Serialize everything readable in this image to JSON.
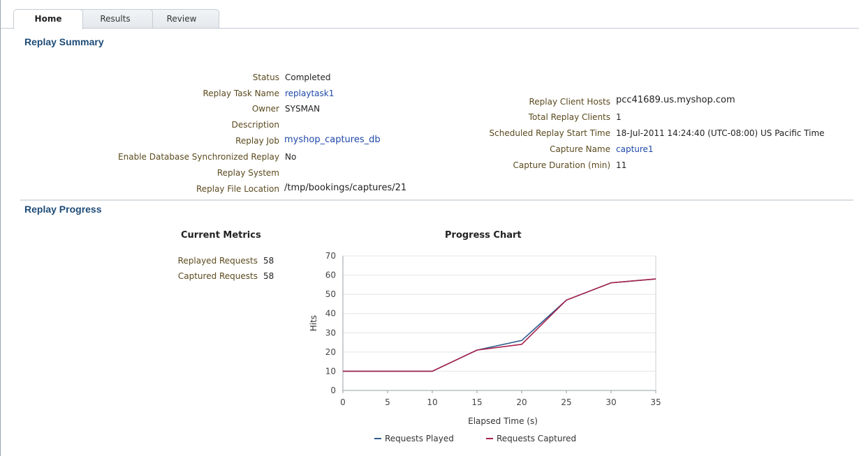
{
  "tabs": [
    {
      "label": "Home",
      "active": true
    },
    {
      "label": "Results",
      "active": false
    },
    {
      "label": "Review",
      "active": false
    }
  ],
  "replay_summary": {
    "title": "Replay Summary",
    "left_fields": [
      {
        "label": "Status",
        "value": "Completed"
      },
      {
        "label": "Replay Task Name",
        "value": "replaytask1"
      },
      {
        "label": "Owner",
        "value": "SYSMAN"
      },
      {
        "label": "Description",
        "value": ""
      },
      {
        "label": "Replay Job",
        "value": "myshop_captures_db"
      },
      {
        "label": "Enable Database Synchronized Replay",
        "value": "No"
      },
      {
        "label": "Replay System",
        "value": ""
      },
      {
        "label": "Replay File Location",
        "value": "/tmp/bookings/captures/21"
      }
    ],
    "right_fields": [
      {
        "label": "Replay Client Hosts",
        "value": "pcc41689.us.myshop.com"
      },
      {
        "label": "Total Replay Clients",
        "value": "1"
      },
      {
        "label": "Scheduled Replay Start Time",
        "value": "18-Jul-2011 14:24:40 (UTC-08:00) US Pacific Time"
      },
      {
        "label": "Capture Name",
        "value": "capture1"
      },
      {
        "label": "Capture Duration (min)",
        "value": "11"
      }
    ]
  },
  "replay_progress": {
    "title": "Replay Progress",
    "metrics_title": "Current Metrics",
    "metrics": [
      {
        "label": "Replayed Requests",
        "value": "58"
      },
      {
        "label": "Captured Requests",
        "value": "58"
      }
    ],
    "chart_title": "Progress Chart"
  },
  "colors": {
    "section_title": "#1d4b77",
    "label": "#5a4a1e",
    "link": "#1e48a8",
    "series_played": "#2f5b8c",
    "series_captured": "#a8224e"
  },
  "chart_data": {
    "type": "line",
    "title": "Progress Chart",
    "xlabel": "Elapsed Time (s)",
    "ylabel": "Hits",
    "x": [
      0,
      10,
      15,
      20,
      25,
      30,
      35
    ],
    "xlim": [
      0,
      35
    ],
    "ylim": [
      0,
      70
    ],
    "xticks": [
      0,
      5,
      10,
      15,
      20,
      25,
      30,
      35
    ],
    "yticks": [
      0,
      10,
      20,
      30,
      40,
      50,
      60,
      70
    ],
    "grid": true,
    "legend": "bottom",
    "series": [
      {
        "name": "Requests Played",
        "values": [
          10,
          10,
          21,
          26,
          47,
          56,
          58
        ],
        "color": "#2f5b8c"
      },
      {
        "name": "Requests Captured",
        "values": [
          10,
          10,
          21,
          24,
          47,
          56,
          58
        ],
        "color": "#a8224e"
      }
    ]
  }
}
